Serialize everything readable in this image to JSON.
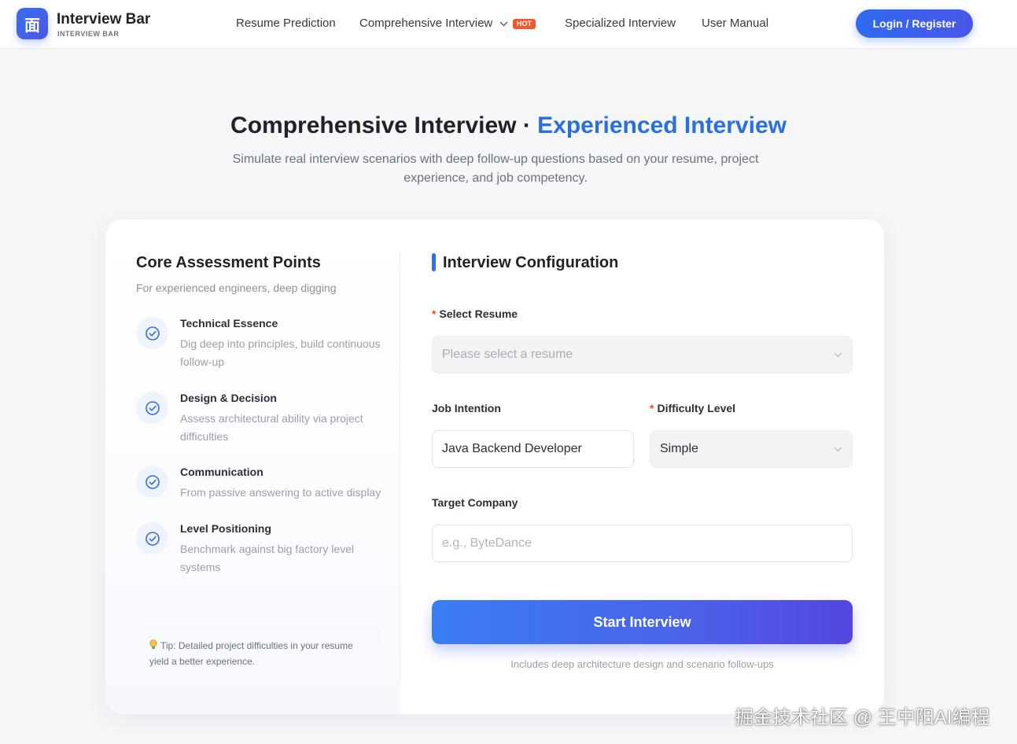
{
  "header": {
    "logo_glyph": "面",
    "brand": "Interview Bar",
    "brand_sub": "INTERVIEW BAR",
    "nav": {
      "resume_prediction": "Resume Prediction",
      "comprehensive_interview": "Comprehensive Interview",
      "hot_badge": "HOT",
      "specialized_interview": "Specialized Interview",
      "user_manual": "User Manual"
    },
    "login_label": "Login / Register"
  },
  "hero": {
    "title_main": "Comprehensive Interview · ",
    "title_accent": "Experienced Interview",
    "description": "Simulate real interview scenarios with deep follow-up questions based on your resume, project experience, and job competency."
  },
  "core": {
    "title": "Core Assessment Points",
    "subtitle": "For experienced engineers, deep digging",
    "points": [
      {
        "title": "Technical Essence",
        "desc": "Dig deep into principles, build continuous follow-up"
      },
      {
        "title": "Design & Decision",
        "desc": "Assess architectural ability via project difficulties"
      },
      {
        "title": "Communication",
        "desc": "From passive answering to active display"
      },
      {
        "title": "Level Positioning",
        "desc": "Benchmark against big factory level systems"
      }
    ],
    "tip": "Tip: Detailed project difficulties in your resume yield a better experience."
  },
  "config": {
    "title": "Interview Configuration",
    "required_mark": "*",
    "resume_label": "Select Resume",
    "resume_placeholder": "Please select a resume",
    "job_label": "Job Intention",
    "job_value": "Java Backend Developer",
    "difficulty_label": "Difficulty Level",
    "difficulty_value": "Simple",
    "company_label": "Target Company",
    "company_placeholder": "e.g., ByteDance",
    "start_label": "Start Interview",
    "start_note": "Includes deep architecture design and scenario follow-ups"
  },
  "watermark": "掘金技术社区 @ 王中阳AI编程",
  "colors": {
    "accent": "#2b6ee0",
    "primary_button": "#2f6bef",
    "hot_badge": "#f05a2b",
    "required": "#f0473c"
  }
}
